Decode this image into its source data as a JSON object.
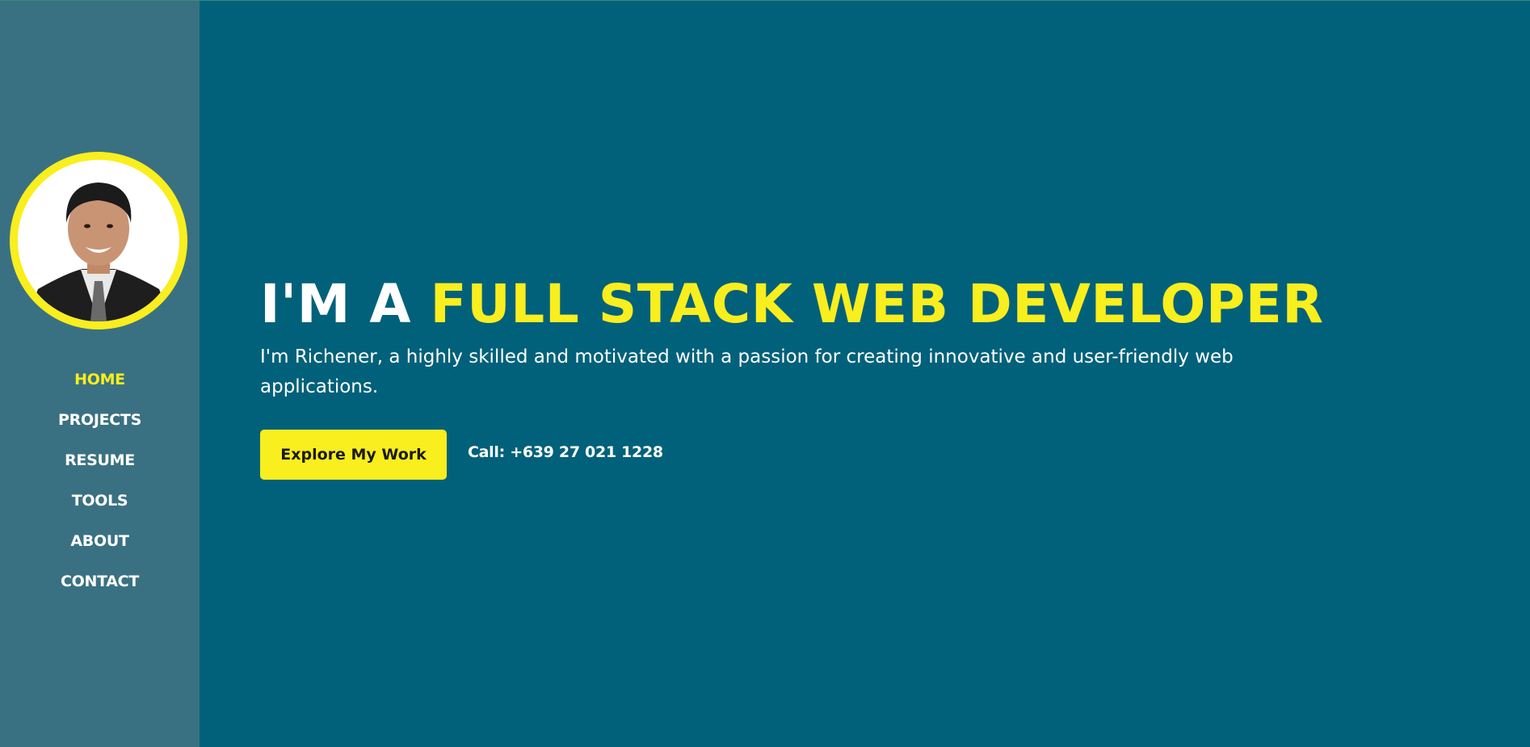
{
  "colors": {
    "background": "#02617a",
    "sidebar": "#3a7182",
    "accent": "#f9ee1e",
    "text": "#ffffff"
  },
  "profile": {
    "avatar_icon": "profile-photo"
  },
  "nav": {
    "items": [
      {
        "label": "HOME",
        "active": true
      },
      {
        "label": "PROJECTS",
        "active": false
      },
      {
        "label": "RESUME",
        "active": false
      },
      {
        "label": "TOOLS",
        "active": false
      },
      {
        "label": "ABOUT",
        "active": false
      },
      {
        "label": "CONTACT",
        "active": false
      }
    ]
  },
  "hero": {
    "headline_prefix": "I'M A ",
    "headline_accent": "FULL STACK WEB DEVELOPER",
    "intro": "I'm Richener, a highly skilled and motivated with a passion for creating innovative and user-friendly web applications.",
    "cta_label": "Explore My Work",
    "phone": "Call: +639 27 021 1228"
  }
}
